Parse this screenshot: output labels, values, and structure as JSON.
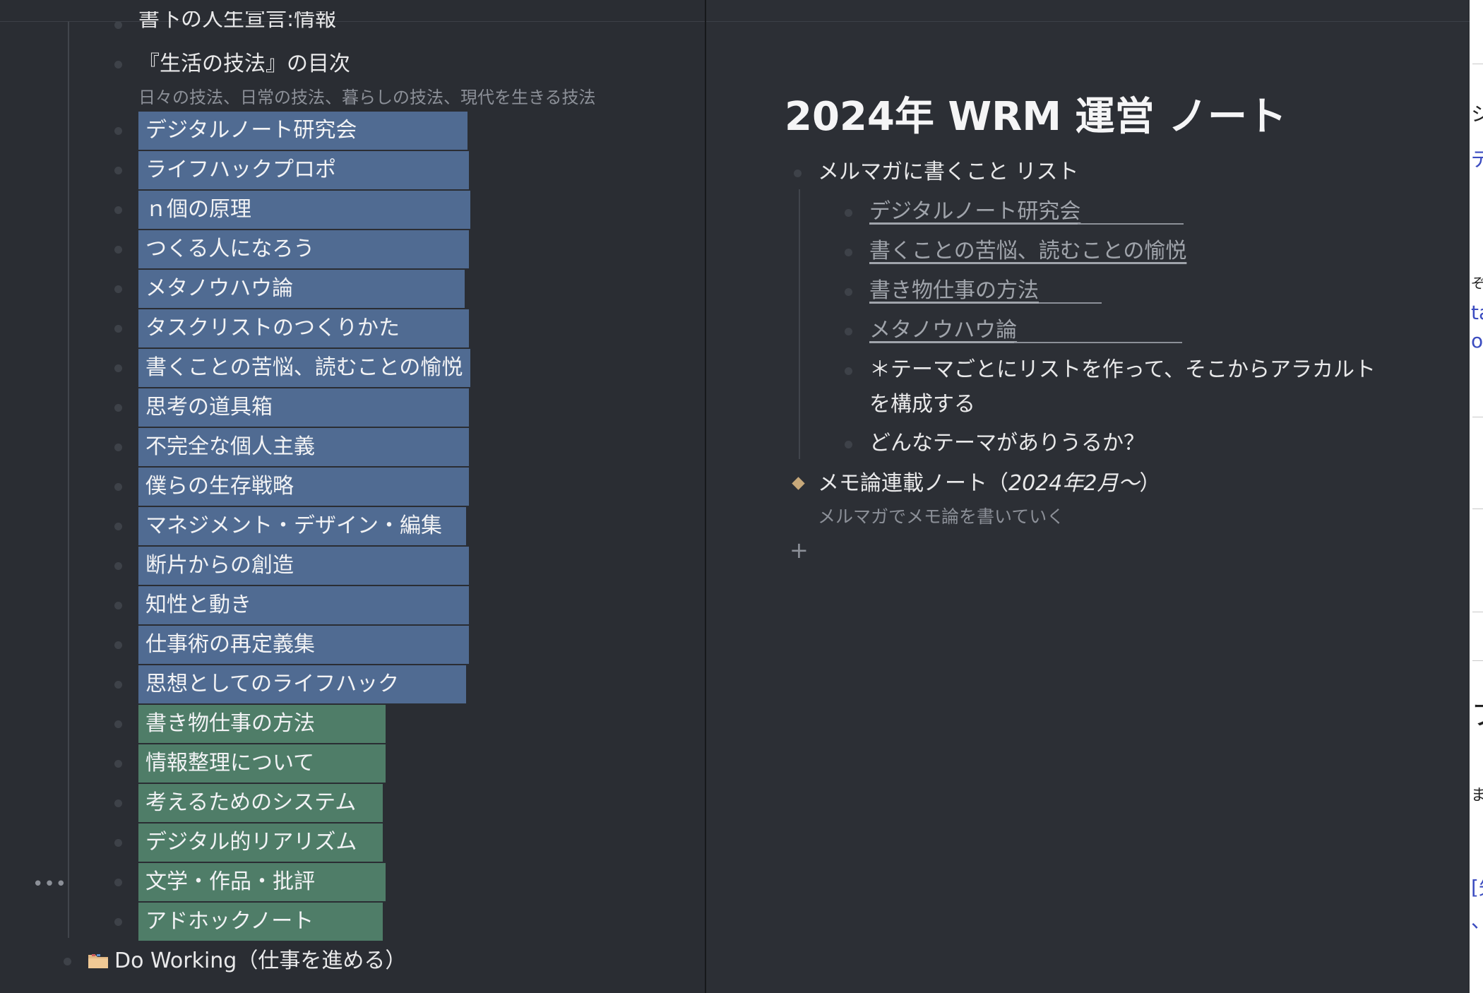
{
  "left": {
    "top_cut_item": "書下の人生宣言:情報",
    "toc_item": {
      "title": "『生活の技法』の目次",
      "note": "日々の技法、日常の技法、暮らしの技法、現代を生きる技法"
    },
    "blue_tiles": [
      "デジタルノート研究会",
      "ライフハックプロポ",
      "ｎ個の原理",
      "つくる人になろう",
      "メタノウハウ論",
      "タスクリストのつくりかた",
      "書くことの苦悩、読むことの愉悦",
      "思考の道具箱",
      "不完全な個人主義",
      "僕らの生存戦略",
      "マネジメント・デザイン・編集",
      "断片からの創造",
      "知性と動き",
      "仕事術の再定義集",
      "思想としてのライフハック"
    ],
    "green_tiles": [
      "書き物仕事の方法",
      "情報整理について",
      "考えるためのシステム",
      "デジタル的リアリズム",
      "文学・作品・批評",
      "アドホックノート"
    ],
    "more_label": "•••",
    "do_working": "Do Working（仕事を進める）",
    "folder_icon": "folder-icon",
    "colors": {
      "blue_tile": "#506b92",
      "green_tile": "#4f7d68"
    }
  },
  "right": {
    "title": "2024年 WRM 運営 ノート",
    "list_title": "メルマガに書くこと リスト",
    "links": [
      "デジタルノート研究会",
      "書くことの苦悩、読むことの愉悦",
      "書き物仕事の方法",
      "メタノウハウ論"
    ],
    "theme_line1": "＊テーマごとにリストを作って、そこからアラカルト",
    "theme_line2": "を構成する",
    "question": "どんなテーマがありうるか？",
    "memo_title": "メモ論連載ノート（",
    "memo_title_italic": "2024年2月〜",
    "memo_title_close": "）",
    "memo_note": "メルマガでメモ論を書いていく",
    "add_label": "+",
    "diamond_color": "#c7a87a"
  }
}
